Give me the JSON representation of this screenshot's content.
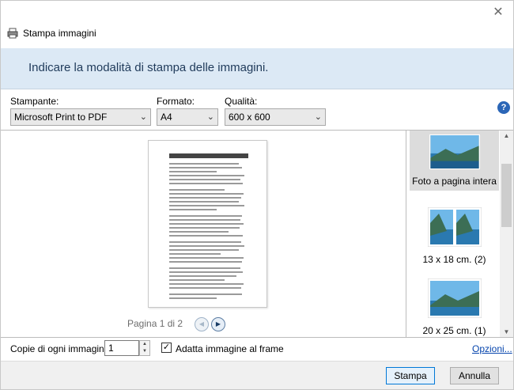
{
  "window": {
    "title": "Stampa immagini",
    "close_icon": "close-icon"
  },
  "banner": {
    "text": "Indicare la modalità di stampa delle immagini."
  },
  "options": {
    "printer_label": "Stampante:",
    "printer_value": "Microsoft Print to PDF",
    "paper_label": "Formato:",
    "paper_value": "A4",
    "quality_label": "Qualità:",
    "quality_value": "600 x 600",
    "help_text": "?"
  },
  "preview": {
    "page_label": "Pagina 1 di 2"
  },
  "layouts": {
    "items": [
      {
        "label": "Foto a pagina intera",
        "selected": true
      },
      {
        "label": "13 x 18 cm. (2)",
        "selected": false
      },
      {
        "label": "20 x 25 cm. (1)",
        "selected": false
      }
    ]
  },
  "bottom": {
    "copies_label": "Copie di ogni immagine:",
    "copies_value": "1",
    "fit_label": "Adatta immagine al frame",
    "fit_checked": true,
    "options_link": "Opzioni..."
  },
  "buttons": {
    "print": "Stampa",
    "cancel": "Annulla"
  },
  "colors": {
    "banner_bg": "#dce9f5",
    "link": "#0645ad",
    "help_bg": "#2b66b7"
  }
}
